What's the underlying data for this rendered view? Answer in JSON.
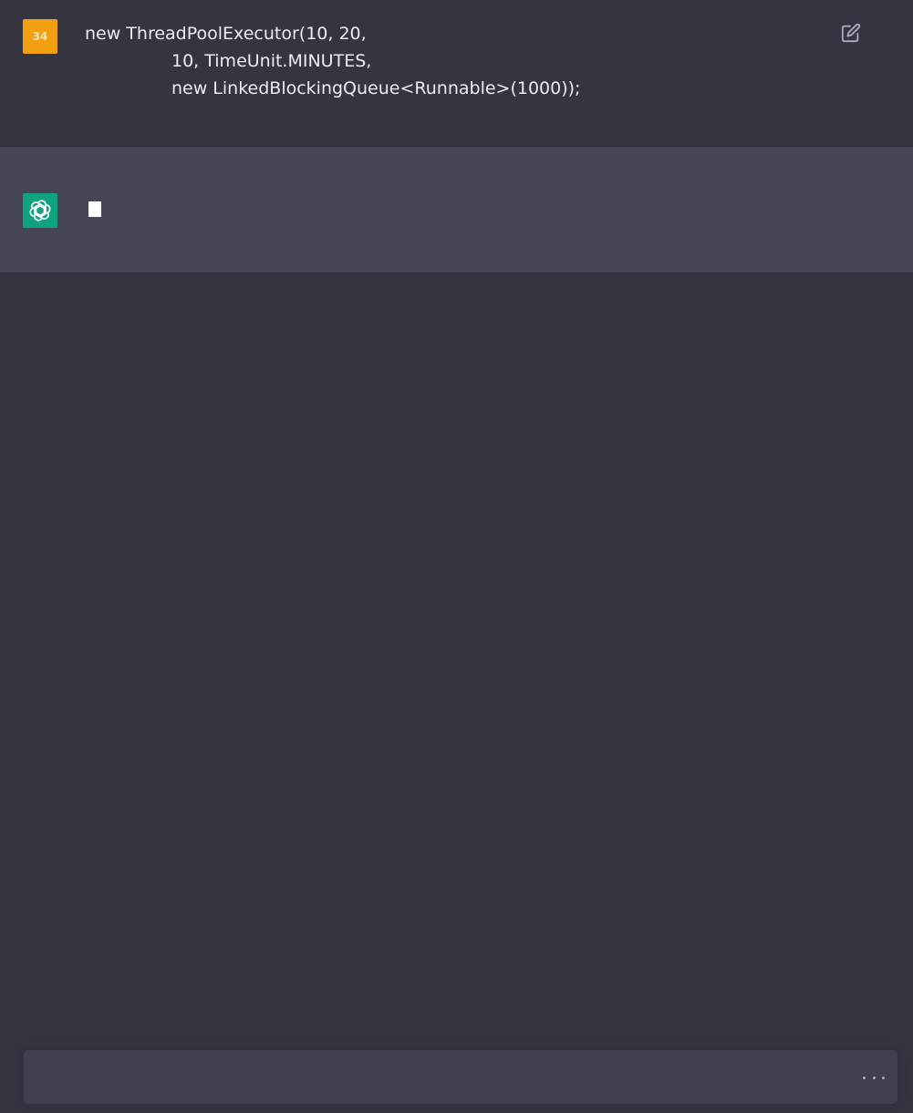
{
  "user_message": {
    "avatar_label": "34",
    "lines": [
      "new ThreadPoolExecutor(10, 20,",
      "10, TimeUnit.MINUTES,",
      "new LinkedBlockingQueue<Runnable>(1000));"
    ],
    "edit_icon": "edit-icon"
  },
  "assistant_message": {
    "avatar_icon": "openai-logo-icon",
    "state": "streaming-cursor"
  },
  "composer": {
    "value": "",
    "placeholder": "",
    "status_icon": "loading-dots-icon"
  },
  "colors": {
    "background": "#343541",
    "assistant_background": "#444654",
    "user_avatar": "#f29f11",
    "bot_avatar": "#10a37f",
    "composer_background": "#40414f"
  }
}
